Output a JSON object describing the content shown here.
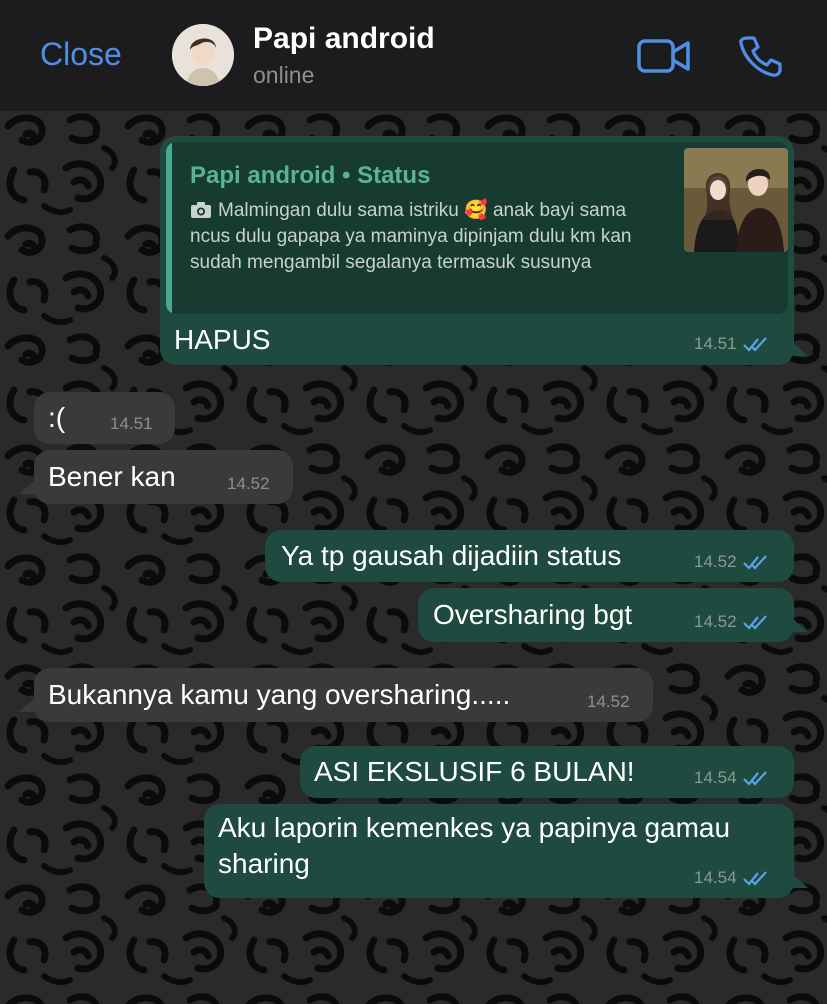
{
  "header": {
    "close_label": "Close",
    "contact_name": "Papi android",
    "contact_status": "online",
    "accent_color": "#4f8fe6",
    "icons": [
      "video-call-icon",
      "phone-call-icon"
    ]
  },
  "quoted_status": {
    "title": "Papi android • Status",
    "text": "Malmingan dulu sama istriku 🥰 anak bayi sama ncus dulu gapapa ya maminya dipinjam dulu km kan sudah mengambil segalanya termasuk susunya",
    "icon": "camera-icon"
  },
  "messages": [
    {
      "dir": "out",
      "text": "HAPUS",
      "time": "14.51",
      "read": true
    },
    {
      "dir": "in",
      "text": ":(",
      "time": "14.51"
    },
    {
      "dir": "in",
      "text": "Bener kan",
      "time": "14.52"
    },
    {
      "dir": "out",
      "text": "Ya tp gausah dijadiin status",
      "time": "14.52",
      "read": true
    },
    {
      "dir": "out",
      "text": "Oversharing bgt",
      "time": "14.52",
      "read": true
    },
    {
      "dir": "in",
      "text": "Bukannya kamu yang oversharing.....",
      "time": "14.52"
    },
    {
      "dir": "out",
      "text": "ASI EKSLUSIF 6 BULAN!",
      "time": "14.54",
      "read": true
    },
    {
      "dir": "out",
      "text_line1": "Aku laporin kemenkes ya papinya gamau",
      "text_line2": "sharing",
      "time": "14.54",
      "read": true
    }
  ],
  "colors": {
    "outgoing_bubble": "#1f4a3f",
    "incoming_bubble": "#3a3a3c",
    "read_ticks": "#5fa0e8",
    "quote_title": "#5ab494"
  }
}
